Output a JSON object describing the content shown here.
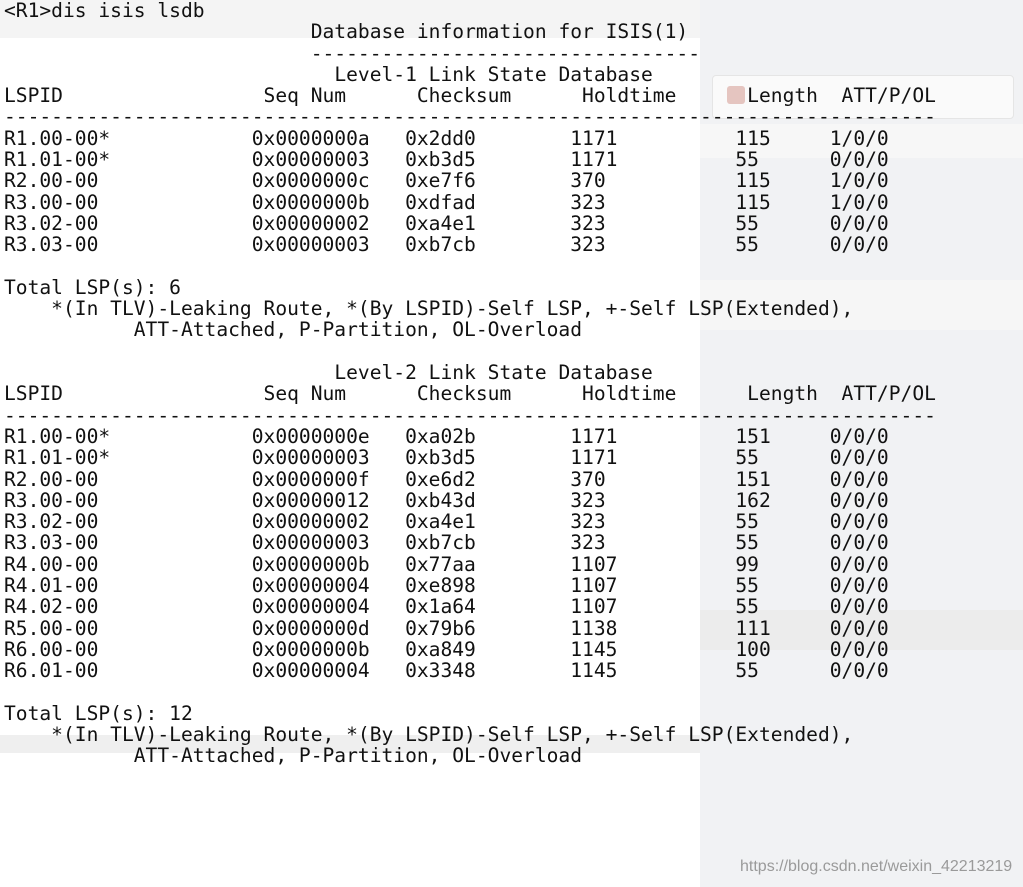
{
  "terminal": {
    "prompt": "<R1>dis isis lsdb",
    "db_title": "Database information for ISIS(1)",
    "db_underline": "---------------------------------",
    "level1": {
      "title": "Level-1 Link State Database",
      "header": "LSPID                 Seq Num      Checksum      Holdtime      Length  ATT/P/OL",
      "divider": "-------------------------------------------------------------------------------",
      "rows": [
        "R1.00-00*            0x0000000a   0x2dd0        1171          115     1/0/0",
        "R1.01-00*            0x00000003   0xb3d5        1171          55      0/0/0",
        "R2.00-00             0x0000000c   0xe7f6        370           115     1/0/0",
        "R3.00-00             0x0000000b   0xdfad        323           115     1/0/0",
        "R3.02-00             0x00000002   0xa4e1        323           55      0/0/0",
        "R3.03-00             0x00000003   0xb7cb        323           55      0/0/0"
      ],
      "total": "Total LSP(s): 6",
      "legend1": "    *(In TLV)-Leaking Route, *(By LSPID)-Self LSP, +-Self LSP(Extended),",
      "legend2": "           ATT-Attached, P-Partition, OL-Overload"
    },
    "level2": {
      "title": "Level-2 Link State Database",
      "header": "LSPID                 Seq Num      Checksum      Holdtime      Length  ATT/P/OL",
      "divider": "-------------------------------------------------------------------------------",
      "rows": [
        "R1.00-00*            0x0000000e   0xa02b        1171          151     0/0/0",
        "R1.01-00*            0x00000003   0xb3d5        1171          55      0/0/0",
        "R2.00-00             0x0000000f   0xe6d2        370           151     0/0/0",
        "R3.00-00             0x00000012   0xb43d        323           162     0/0/0",
        "R3.02-00             0x00000002   0xa4e1        323           55      0/0/0",
        "R3.03-00             0x00000003   0xb7cb        323           55      0/0/0",
        "R4.00-00             0x0000000b   0x77aa        1107          99      0/0/0",
        "R4.01-00             0x00000004   0xe898        1107          55      0/0/0",
        "R4.02-00             0x00000004   0x1a64        1107          55      0/0/0",
        "R5.00-00             0x0000000d   0x79b6        1138          111     0/0/0",
        "R6.00-00             0x0000000b   0xa849        1145          100     0/0/0",
        "R6.01-00             0x00000004   0x3348        1145          55      0/0/0"
      ],
      "total": "Total LSP(s): 12",
      "legend1": "    *(In TLV)-Leaking Route, *(By LSPID)-Self LSP, +-Self LSP(Extended),",
      "legend2": "           ATT-Attached, P-Partition, OL-Overload"
    }
  },
  "watermark": "https://blog.csdn.net/weixin_42213219"
}
